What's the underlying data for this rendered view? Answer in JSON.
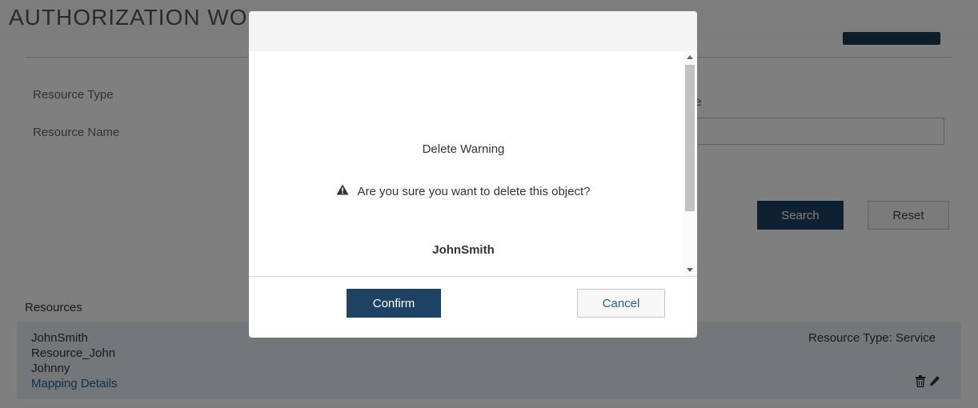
{
  "page": {
    "title": "AUTHORIZATION WO",
    "filters": {
      "resource_type_label": "Resource Type",
      "resource_name_label": "Resource Name",
      "range_label_partial": "ge"
    },
    "search_label": "Search",
    "reset_label": "Reset",
    "resources_heading": "Resources",
    "resource": {
      "name": "JohnSmith",
      "alias": "Resource_John",
      "nickname": "Johnny",
      "link_label": "Mapping Details",
      "type_text": "Resource Type: Service"
    }
  },
  "modal": {
    "title": "Delete Warning",
    "warning_icon": "warning-triangle-icon",
    "message": "Are you sure you want to delete this object?",
    "object_name": "JohnSmith",
    "confirm_label": "Confirm",
    "cancel_label": "Cancel"
  },
  "colors": {
    "primary_button": "#1e4262",
    "link": "#2a5d8f",
    "resource_card": "#e6eef4"
  }
}
